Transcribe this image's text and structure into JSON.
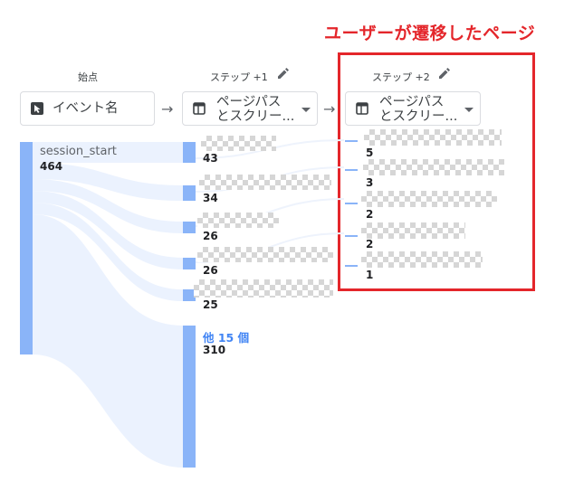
{
  "annotation": {
    "text": "ユーザーが遷移したページ",
    "color": "#e4262b"
  },
  "columns": [
    {
      "header": "始点",
      "dimension": "イベント名",
      "editable": false
    },
    {
      "header": "ステップ +1",
      "dimension_line1": "ページパス",
      "dimension_line2": "とスクリー...",
      "editable": true
    },
    {
      "header": "ステップ +2",
      "dimension_line1": "ページパス",
      "dimension_line2": "とスクリー...",
      "editable": true
    }
  ],
  "start_node": {
    "label": "session_start",
    "value": "464"
  },
  "step1_nodes": [
    {
      "value": "43"
    },
    {
      "value": "34"
    },
    {
      "value": "26"
    },
    {
      "value": "26"
    },
    {
      "value": "25"
    }
  ],
  "step1_other": {
    "label": "他 15 個",
    "value": "310"
  },
  "step2_nodes": [
    {
      "value": "5"
    },
    {
      "value": "3"
    },
    {
      "value": "2"
    },
    {
      "value": "2"
    },
    {
      "value": "1"
    }
  ],
  "icons": {
    "cursor": "cursor-icon",
    "table": "table-icon",
    "edit": "pencil-icon",
    "arrow": "arrow-right-icon",
    "caret": "caret-down-icon"
  },
  "colors": {
    "node": "#8ab4f8",
    "flow": "#e8f0fe",
    "others_text": "#4285f4"
  }
}
